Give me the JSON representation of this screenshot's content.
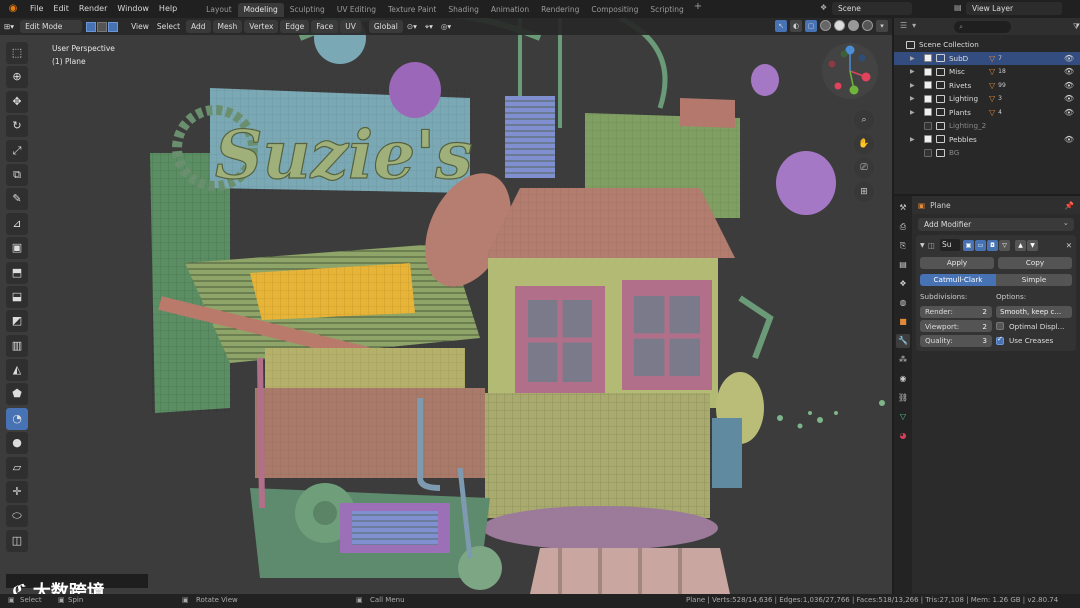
{
  "topbar": {
    "menus": [
      "File",
      "Edit",
      "Render",
      "Window",
      "Help"
    ],
    "workspaces": [
      "Layout",
      "Modeling",
      "Sculpting",
      "UV Editing",
      "Texture Paint",
      "Shading",
      "Animation",
      "Rendering",
      "Compositing",
      "Scripting"
    ],
    "active_workspace": "Modeling",
    "add_tab": "+",
    "scene": "Scene",
    "view_layer": "View Layer"
  },
  "viewport_header": {
    "mode": "Edit Mode",
    "menus": [
      "View",
      "Select",
      "Add",
      "Mesh",
      "Vertex",
      "Edge",
      "Face",
      "UV"
    ],
    "transform_orientation": "Global"
  },
  "viewport_info": {
    "perspective": "User Perspective",
    "object": "(1) Plane"
  },
  "model_text": "Suzie's",
  "outliner": {
    "root": "Scene Collection",
    "search_placeholder": "",
    "collections": [
      {
        "name": "SubD",
        "selected": true,
        "checked": true,
        "badge": "7"
      },
      {
        "name": "Misc",
        "selected": false,
        "checked": true,
        "badge": "18"
      },
      {
        "name": "Rivets",
        "selected": false,
        "checked": true,
        "badge": "99"
      },
      {
        "name": "Lighting",
        "selected": false,
        "checked": true,
        "badge": "3"
      },
      {
        "name": "Plants",
        "selected": false,
        "checked": true,
        "badge": "4"
      },
      {
        "name": "Lighting_2",
        "selected": false,
        "checked": false,
        "badge": ""
      },
      {
        "name": "Pebbles",
        "selected": false,
        "checked": true,
        "badge": ""
      },
      {
        "name": "BG",
        "selected": false,
        "checked": false,
        "badge": ""
      }
    ]
  },
  "properties": {
    "object_name": "Plane",
    "add_modifier": "Add Modifier",
    "modifier_name": "Su",
    "apply": "Apply",
    "copy": "Copy",
    "catmull_clark": "Catmull-Clark",
    "simple": "Simple",
    "subdivisions_label": "Subdivisions:",
    "options_label": "Options:",
    "render_label": "Render:",
    "render_value": "2",
    "viewport_label": "Viewport:",
    "viewport_value": "2",
    "quality_label": "Quality:",
    "quality_value": "3",
    "uv_smooth": "Smooth, keep c...",
    "optimal_display": "Optimal Displ...",
    "use_creases": "Use Creases"
  },
  "statusbar": {
    "select": "Select",
    "spin": "Spin",
    "rotate_view": "Rotate View",
    "call_menu": "Call Menu",
    "stats": "Plane | Verts:528/14,636 | Edges:1,036/27,766 | Faces:518/13,266 | Tris:27,108 | Mem: 1.26 GB | v2.80.74"
  },
  "watermark": {
    "text": "大数跨境"
  },
  "colors": {
    "accent": "#4772b3",
    "brand_orange": "#e87d0d",
    "selection_row": "#334d80"
  }
}
